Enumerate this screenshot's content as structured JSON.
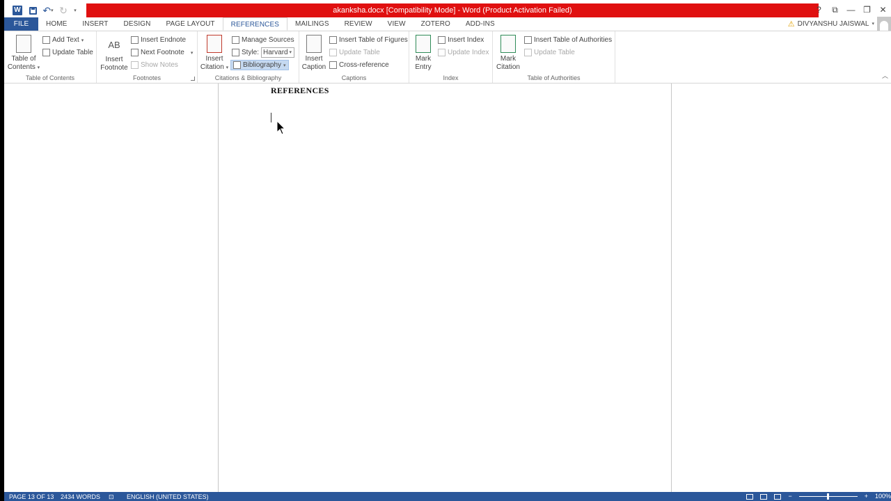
{
  "titlebar": {
    "title": "akanksha.docx [Compatibility Mode] - Word (Product Activation Failed)",
    "window_controls": [
      "?",
      "ribbon-options",
      "minimize",
      "restore",
      "close"
    ]
  },
  "quick_access": {
    "app_icon": "W",
    "items": [
      "save-icon",
      "undo-icon",
      "redo-icon",
      "customize-icon"
    ]
  },
  "tabs": [
    "FILE",
    "HOME",
    "INSERT",
    "DESIGN",
    "PAGE LAYOUT",
    "REFERENCES",
    "MAILINGS",
    "REVIEW",
    "VIEW",
    "ZOTERO",
    "ADD-INS"
  ],
  "active_tab": "REFERENCES",
  "user": {
    "name": "DIVYANSHU JAISWAL"
  },
  "ribbon": {
    "toc": {
      "title": "Table of Contents",
      "big_label_1": "Table of",
      "big_label_2": "Contents",
      "add_text": "Add Text",
      "update_table": "Update Table"
    },
    "footnotes": {
      "title": "Footnotes",
      "icon_text": "AB",
      "big_label_1": "Insert",
      "big_label_2": "Footnote",
      "insert_endnote": "Insert Endnote",
      "next_footnote": "Next Footnote",
      "show_notes": "Show Notes"
    },
    "citations": {
      "title": "Citations & Bibliography",
      "big_label_1": "Insert",
      "big_label_2": "Citation",
      "manage_sources": "Manage Sources",
      "style_label": "Style:",
      "style_value": "Harvard",
      "bibliography": "Bibliography"
    },
    "captions": {
      "title": "Captions",
      "big_label_1": "Insert",
      "big_label_2": "Caption",
      "insert_table_of_figures": "Insert Table of Figures",
      "update_table": "Update Table",
      "cross_reference": "Cross-reference"
    },
    "index": {
      "title": "Index",
      "big_label_1": "Mark",
      "big_label_2": "Entry",
      "insert_index": "Insert Index",
      "update_index": "Update Index"
    },
    "authorities": {
      "title": "Table of Authorities",
      "big_label_1": "Mark",
      "big_label_2": "Citation",
      "insert_toa": "Insert Table of Authorities",
      "update_table": "Update Table"
    }
  },
  "document": {
    "heading": "REFERENCES"
  },
  "statusbar": {
    "page": "PAGE 13 OF 13",
    "words": "2434 WORDS",
    "language": "ENGLISH (UNITED STATES)",
    "zoom": "100%"
  },
  "colors": {
    "accent": "#2b579a",
    "titlebar_alert": "#e01010"
  }
}
